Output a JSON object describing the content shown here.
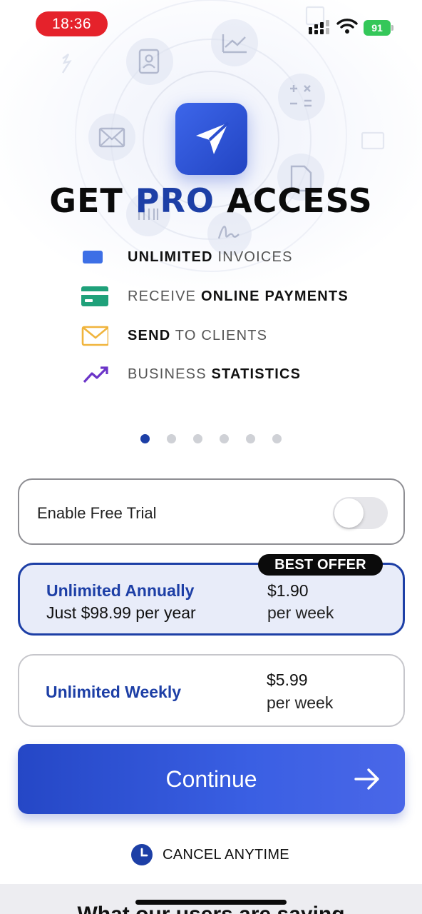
{
  "status_bar": {
    "time": "18:36",
    "battery": "91",
    "signal_icon": "cellular-signal-icon",
    "wifi_icon": "wifi-icon"
  },
  "hero": {
    "title_part1": "GET ",
    "title_accent": "PRO",
    "title_part2": " ACCESS",
    "logo_icon": "paper-plane-icon",
    "accent_color": "#1d3fa6"
  },
  "features": [
    {
      "icon": "invoice-icon",
      "bold": "UNLIMITED",
      "text": " INVOICES",
      "bold_first": true,
      "color": "#3d6fe6"
    },
    {
      "icon": "credit-card-icon",
      "text": "RECEIVE ",
      "bold": "ONLINE PAYMENTS",
      "bold_first": false,
      "color": "#1fa17a"
    },
    {
      "icon": "envelope-icon",
      "bold": "SEND",
      "text": " TO CLIENTS",
      "bold_first": true,
      "color": "#f0b43c"
    },
    {
      "icon": "trending-up-icon",
      "text": "BUSINESS ",
      "bold": "STATISTICS",
      "bold_first": false,
      "color": "#6b34c8"
    }
  ],
  "pager": {
    "count": 6,
    "active": 0
  },
  "trial": {
    "label": "Enable Free Trial",
    "enabled": false
  },
  "plans": {
    "annual": {
      "badge": "BEST OFFER",
      "name": "Unlimited Annually",
      "sub": "Just $98.99 per year",
      "price": "$1.90",
      "per": "per week",
      "selected": true
    },
    "weekly": {
      "name": "Unlimited Weekly",
      "price": "$5.99",
      "per": "per week",
      "selected": false
    }
  },
  "continue": {
    "label": "Continue",
    "arrow_icon": "arrow-right-icon"
  },
  "cancel": {
    "label": "CANCEL ANYTIME",
    "icon": "clock-icon"
  },
  "bottom": {
    "heading": "What our users are saying"
  }
}
